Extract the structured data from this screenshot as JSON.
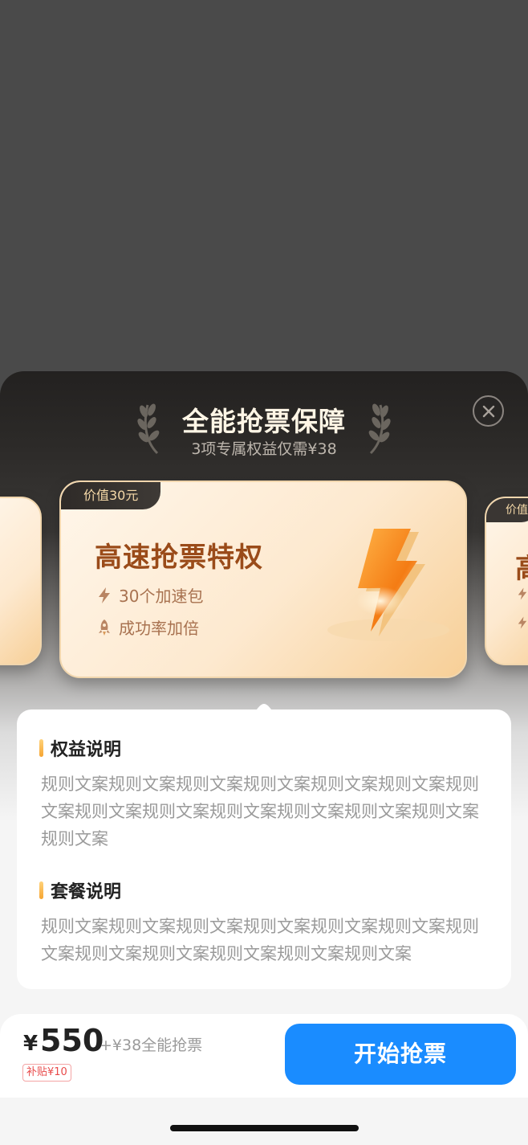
{
  "header": {
    "title": "全能抢票保障",
    "subtitle": "3项专属权益仅需¥38"
  },
  "cards": {
    "main": {
      "badge": "价值30元",
      "title": "高速抢票特权",
      "features": [
        "30个加速包",
        "成功率加倍"
      ]
    },
    "right": {
      "badge": "价值",
      "title": "高"
    }
  },
  "info": {
    "section1_title": "权益说明",
    "section1_text": "规则文案规则文案规则文案规则文案规则文案规则文案规则文案规则文案规则文案规则文案规则文案规则文案规则文案规则文案",
    "section2_title": "套餐说明",
    "section2_text": "规则文案规则文案规则文案规则文案规则文案规则文案规则文案规则文案规则文案规则文案规则文案规则文案"
  },
  "bottom": {
    "currency": "¥",
    "price": "550",
    "extra": "+¥38全能抢票",
    "subsidy": "补贴¥10",
    "button": "开始抢票"
  },
  "colors": {
    "primary": "#1a8cff",
    "card_title": "#9a4b19",
    "accent_orange": "#f6a531"
  }
}
